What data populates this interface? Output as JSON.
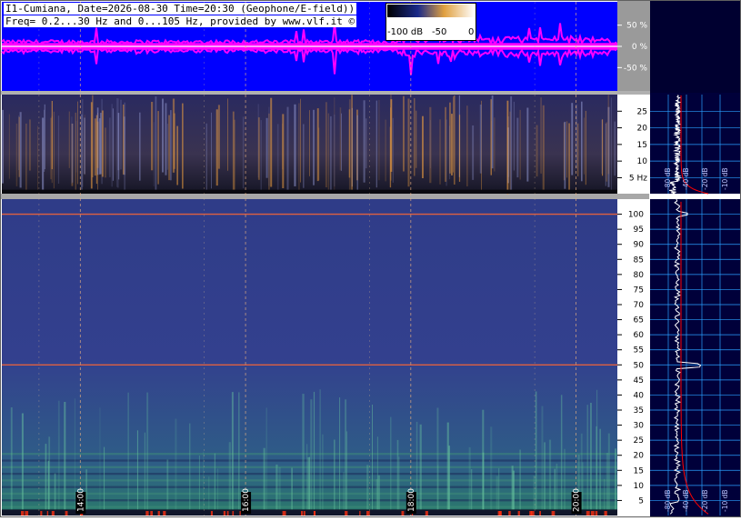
{
  "header": {
    "line1": "I1-Cumiana, Date=2026-08-30 Time=20:30 (Geophone/E-field))",
    "line2": "Freq= 0.2...30 Hz and 0...105 Hz, provided by www.vlf.it ©"
  },
  "colorbar": {
    "ticks": [
      "-100 dB",
      "-50",
      "0"
    ]
  },
  "colors": {
    "waveform_bg": "#0000ff",
    "waveform_line": "#ff00ff",
    "spectrogram_low": "#1a1e55",
    "spectrogram_high": "#f0a040",
    "spectrum_bg": "#00003a",
    "grid": "#2aa0ff",
    "fit_line": "#ff0000"
  },
  "chart_data": [
    {
      "type": "line",
      "panel": "waveform",
      "ylabels": [
        "50 %",
        "0 %",
        "-50 %"
      ],
      "yticks": [
        50,
        0,
        -50
      ],
      "ylim": [
        -105,
        105
      ]
    },
    {
      "type": "heatmap",
      "panel": "spectrogram-low",
      "ylabels": [
        "25",
        "20",
        "15",
        "10",
        "5 Hz"
      ],
      "yticks": [
        25,
        20,
        15,
        10,
        5
      ],
      "ylim": [
        0.2,
        30
      ]
    },
    {
      "type": "heatmap",
      "panel": "spectrogram-high",
      "time_labels": [
        "14:00",
        "16:00",
        "18:00",
        "20:00"
      ],
      "time_hours": [
        14,
        16,
        18,
        20
      ],
      "xlim_hours": [
        13.05,
        20.5
      ],
      "ylabels": [
        "100",
        "95",
        "90",
        "85",
        "80",
        "75",
        "70",
        "65",
        "60",
        "55",
        "50",
        "45",
        "40",
        "35",
        "30",
        "25",
        "20",
        "15",
        "10",
        "5"
      ],
      "yticks": [
        100,
        95,
        90,
        85,
        80,
        75,
        70,
        65,
        60,
        55,
        50,
        45,
        40,
        35,
        30,
        25,
        20,
        15,
        10,
        5
      ],
      "ylim": [
        0,
        105
      ],
      "hum_lines_hz": [
        50,
        100
      ]
    },
    {
      "type": "line",
      "panel": "spectrum-low",
      "xlabels": [
        "-80 dB",
        "-40 dB",
        "-20 dB",
        "-10 dB"
      ],
      "ylim": [
        0.2,
        30
      ]
    },
    {
      "type": "line",
      "panel": "spectrum-high",
      "xlabels": [
        "-80 dB",
        "-40 dB",
        "-20 dB",
        "-10 dB"
      ],
      "ylim": [
        0,
        105
      ]
    }
  ]
}
